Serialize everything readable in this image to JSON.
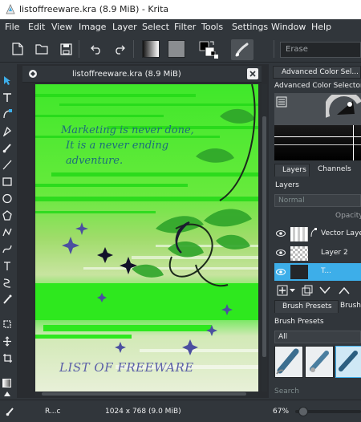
{
  "window": {
    "title": "listoffreeware.kra (8.9 MiB)  - Krita"
  },
  "menubar": {
    "items": [
      "File",
      "Edit",
      "View",
      "Image",
      "Layer",
      "Select",
      "Filter",
      "Tools",
      "Settings",
      "Window",
      "Help"
    ]
  },
  "toolbar": {
    "blend_mode_value": "Erase",
    "icons": [
      "new-document-icon",
      "open-file-icon",
      "save-icon",
      "undo-icon",
      "redo-icon",
      "gradient-preset-icon",
      "pattern-preset-icon",
      "swap-colors-icon",
      "reset-colors-icon",
      "brush-preset-icon"
    ]
  },
  "document": {
    "tab_title": "listoffreeware.kra (8.9 MiB)",
    "canvas_text_lines": [
      "Marketing is never done,",
      "It is a never ending",
      "adventure."
    ],
    "canvas_footer_text": "LIST OF FREEWARE"
  },
  "docker": {
    "color_tab": "Advanced Color Sel...",
    "color_panel_title": "Advanced Color Selector",
    "layers_tabs": [
      "Layers",
      "Channels"
    ],
    "layers_title": "Layers",
    "blend_mode": "Normal",
    "opacity_label": "Opacity:",
    "layers": [
      "Vector Layer",
      "Layer 2",
      "T..."
    ],
    "brush_tabs": [
      "Brush Presets",
      "Brush"
    ],
    "brush_title": "Brush Presets",
    "brush_filter": "All",
    "search_placeholder": "Search"
  },
  "statusbar": {
    "left": "R...c",
    "size": "1024 x 768 (9.0 MiB)",
    "zoom": "67%"
  },
  "colors": {
    "accent": "#3daee9",
    "bg": "#31363b",
    "canvas_green": "#2ee81e"
  }
}
